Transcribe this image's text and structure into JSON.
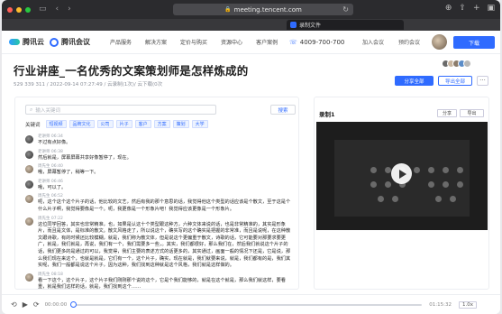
{
  "browser": {
    "url": "meeting.tencent.com",
    "tab_title": "录制文件"
  },
  "nav": {
    "brand_cloud": "腾讯云",
    "brand_meeting": "腾讯会议",
    "links": [
      "产品服务",
      "解决方案",
      "定价与购买",
      "资源中心",
      "客户案例"
    ],
    "phone": "4009-700-700",
    "join_meeting": "加入会议",
    "schedule_meeting": "预约会议",
    "download_label": "下载"
  },
  "page": {
    "title": "行业讲座_一名优秀的文案策划师是怎样炼成的",
    "meta": "529 339 311  /  2022-09-14 07:27:49  /  云录制(1次)/  云下载(0次",
    "share_all": "分享全部",
    "export_all": "导出全部",
    "more": "···"
  },
  "left": {
    "search_placeholder": "输入关键词",
    "search_button": "搜索",
    "keywords_label": "关键词",
    "keywords": [
      "短视频",
      "品牌文化",
      "公司",
      "片子",
      "客户",
      "方案",
      "策划",
      "大学"
    ]
  },
  "transcript": [
    {
      "speaker": "老讲师 06:34",
      "text": "不过有点好像。",
      "av": "a"
    },
    {
      "speaker": "老讲师 06:38",
      "text": "然后就是，屏幕屏幕共享好像暂停了，现在。",
      "av": "a"
    },
    {
      "speaker": "周先生 06:40",
      "text": "哦，屏幕暂停了，稍等一下。",
      "av": "b"
    },
    {
      "speaker": "老讲师 06:46",
      "text": "哦，可以了。",
      "av": "a"
    },
    {
      "speaker": "周先生 06:52",
      "text": "呃，这个这个这个片子的话，他比较的文艺，然后有我的那个意思的话，我觉得他这个类型的话应该是个散文，至于这是个什么片子啊，我觉得要像是一个。呃，我更像是一个形象片吧！我觉得应该更像是一个形象片。",
      "av": "b"
    },
    {
      "speaker": "周先生 07:22",
      "text": "这位同学回答，其实也非常精准，也，如果是认这十个类型跟这种方，六种文体来说的话，也是非常精准的，其实是形象片，而且是文体，是标准的散文。散文风格走了，所以说这个，确实写的这个确实是把握的非常准，而且是说呢，在这种散文跟诗歌，有的时候还比较模糊，就是，我们称为散文体，但是说这个更偏重于散文，诗歌的话，它可能要对那要求要更广，就是，我们就是，再说，我们有一个，我们需要多一些，。其实，我们都很好，那么我们在，然后我们就说这个片子的话，我们更多的是通过的可以，我觉得，我们主要的表述方式的话更多的，其实通过，画面一般的情况下还是，它是说，那么我们现在来这个，也就是就是，它们有一个，这个片子，确实，现在就是，我们就要来说，就是，我们都有的是，我们其实呢，我们一般都是说这个片子，因为这种，我们找到这种就是这个风格，我们就是这样做的。",
      "av": "b"
    },
    {
      "speaker": "周先生 08:18",
      "text": "看一下这个，这个片子，这个片子我们刚刚那个说的这个，它是个我们能够的，就是在这个就是，那么我们就这样，要看重，就是我们这样的话，就是，我们找到这个……",
      "av": "b"
    }
  ],
  "right": {
    "title": "录制1",
    "share": "分享",
    "export": "导出"
  },
  "player": {
    "current": "00:00:00",
    "total": "01:15:32",
    "speed": "1.0x",
    "progress": 0
  },
  "colors": {
    "accent": "#2f6bff"
  }
}
